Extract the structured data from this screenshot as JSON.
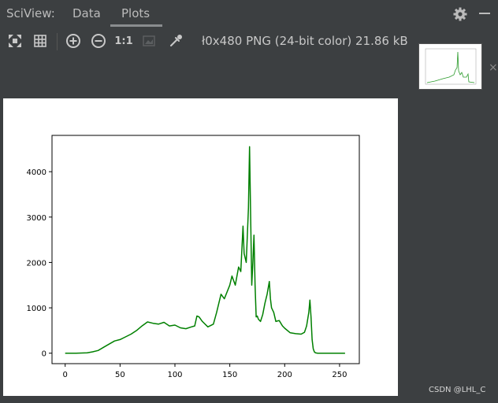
{
  "app": {
    "title": "SciView:"
  },
  "tabs": [
    {
      "label": "Data"
    },
    {
      "label": "Plots"
    }
  ],
  "toolbar": {
    "zoom_actual_label": "1:1",
    "file_info": "ł0x480 PNG (24-bit color) 21.86 kB",
    "icons": [
      "fit-icon",
      "grid-icon",
      "zoom-in-icon",
      "zoom-out-icon",
      "actual-size-icon",
      "background-icon",
      "color-picker-icon"
    ]
  },
  "thumbnail": {
    "close_label": "×"
  },
  "watermark": "CSDN @LHL_C",
  "chart_data": {
    "type": "line",
    "title": "",
    "xlabel": "",
    "ylabel": "",
    "xlim": [
      -12,
      268
    ],
    "ylim": [
      -230,
      4800
    ],
    "xticks": [
      0,
      50,
      100,
      150,
      200,
      250
    ],
    "yticks": [
      0,
      1000,
      2000,
      3000,
      4000
    ],
    "grid": false,
    "color": "#008000",
    "series": [
      {
        "x": [
          0,
          10,
          20,
          25,
          30,
          35,
          40,
          45,
          50,
          55,
          60,
          65,
          70,
          75,
          80,
          85,
          90,
          95,
          100,
          105,
          110,
          115,
          118,
          120,
          122,
          125,
          130,
          135,
          138,
          140,
          142,
          145,
          150,
          152,
          155,
          158,
          160,
          162,
          163,
          165,
          167,
          168,
          169,
          170,
          171,
          172,
          173,
          174,
          175,
          176,
          178,
          180,
          182,
          184,
          186,
          187,
          188,
          190,
          192,
          195,
          198,
          200,
          205,
          210,
          215,
          218,
          220,
          222,
          223,
          224,
          225,
          226,
          227,
          228,
          230,
          235,
          240,
          255
        ],
        "y": [
          0,
          0,
          10,
          30,
          60,
          130,
          200,
          270,
          300,
          360,
          420,
          500,
          600,
          690,
          660,
          640,
          680,
          600,
          620,
          560,
          540,
          580,
          600,
          820,
          800,
          700,
          580,
          640,
          900,
          1100,
          1300,
          1200,
          1500,
          1700,
          1500,
          1900,
          1800,
          2800,
          2200,
          2000,
          3200,
          4550,
          3000,
          1500,
          2000,
          2600,
          1500,
          800,
          820,
          750,
          700,
          850,
          1100,
          1300,
          1580,
          1200,
          1000,
          900,
          700,
          720,
          600,
          550,
          450,
          430,
          420,
          460,
          600,
          900,
          1170,
          800,
          300,
          100,
          30,
          10,
          0,
          0,
          0,
          0
        ]
      }
    ]
  }
}
